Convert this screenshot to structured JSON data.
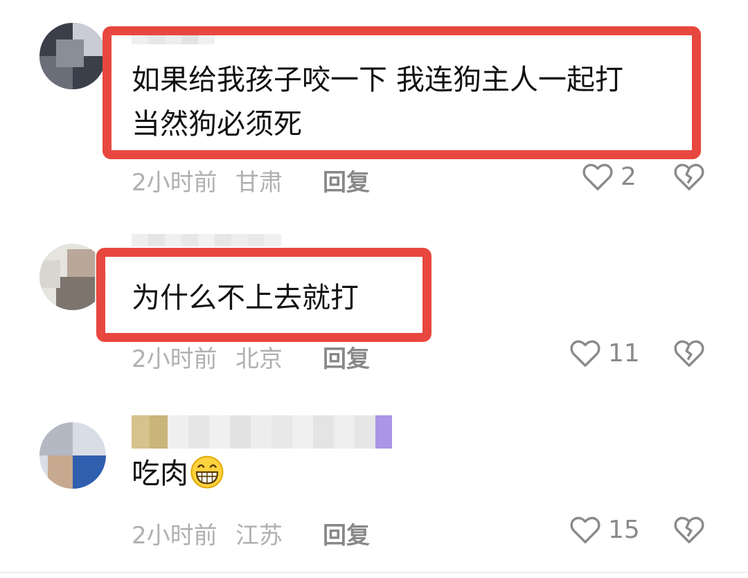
{
  "comments": [
    {
      "text_lines": [
        "如果给我孩子咬一下 我连狗主人一起打",
        "当然狗必须死"
      ],
      "time": "2小时前",
      "location": "甘肃",
      "reply_label": "回复",
      "likes": "2",
      "highlighted": true
    },
    {
      "text_lines": [
        "为什么不上去就打"
      ],
      "time": "2小时前",
      "location": "北京",
      "reply_label": "回复",
      "likes": "11",
      "highlighted": true
    },
    {
      "text_lines": [
        "吃肉"
      ],
      "emoji": "grinning-face-emoji",
      "time": "2小时前",
      "location": "江苏",
      "reply_label": "回复",
      "likes": "15",
      "highlighted": false
    }
  ],
  "icons": {
    "like": "heart-outline-icon",
    "dislike": "broken-heart-icon"
  },
  "colors": {
    "highlight": "#e8473f",
    "meta_text": "#b0b0b0",
    "reply_text": "#888888"
  }
}
